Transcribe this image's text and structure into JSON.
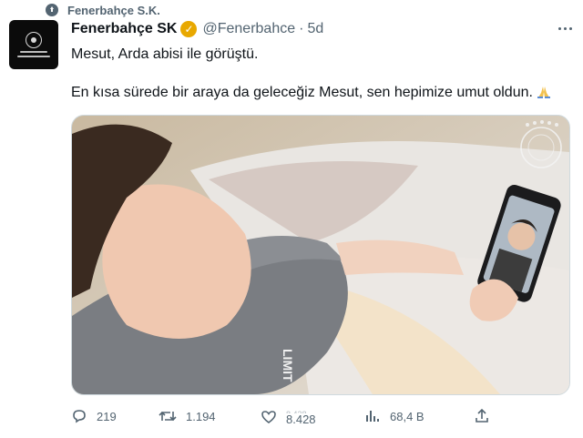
{
  "context": {
    "label": "Fenerbahçe S.K.",
    "icon": "pin-icon"
  },
  "author": {
    "display_name": "Fenerbahçe SK",
    "handle": "@Fenerbahce",
    "separator": "·",
    "timestamp": "5d",
    "verified_badge": "verified-badge-icon",
    "verified_color": "#e8a800"
  },
  "tweet": {
    "line1": "Mesut, Arda abisi ile görüştü.",
    "line2": "En kısa sürede bir araya da geleceğiz Mesut, sen hepimize umut oldun.",
    "emoji": "folded-hands-icon"
  },
  "media": {
    "description_icon": "photo",
    "sleeve_text": "LIMIT"
  },
  "actions": {
    "replies": "219",
    "retweets": "1.194",
    "likes_ghost": "8.428",
    "likes": "8.428",
    "views": "68,4 B"
  },
  "colors": {
    "muted": "#536471",
    "text": "#0f1419",
    "border": "#cfd9de"
  }
}
